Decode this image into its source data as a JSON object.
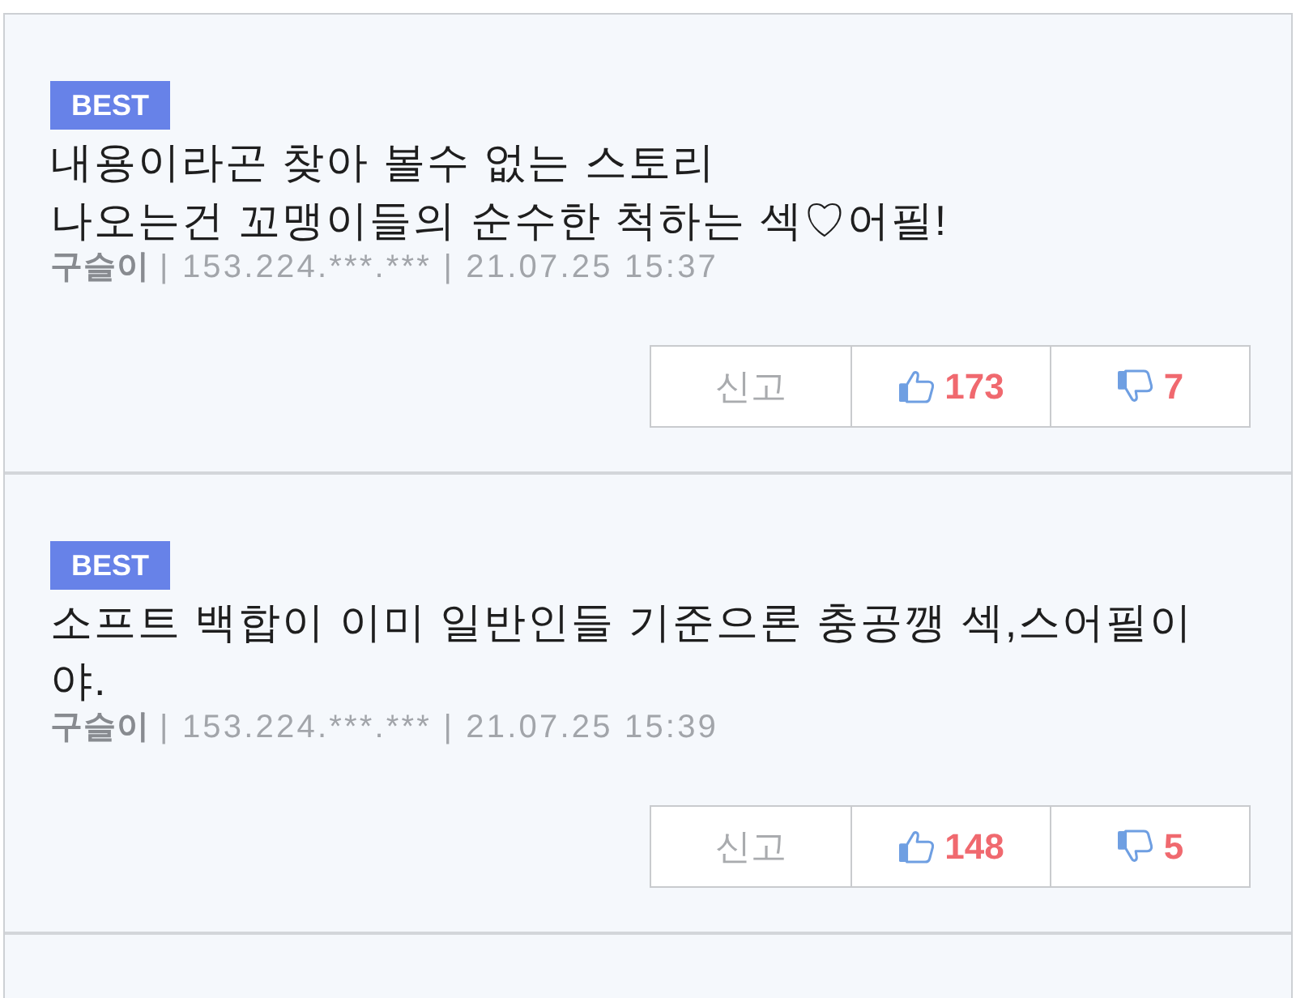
{
  "comments": [
    {
      "badge": "BEST",
      "lines": [
        "내용이라곤 찾아 볼수 없는 스토리",
        "나오는건 꼬맹이들의 순수한 척하는 섹♡어필!"
      ],
      "author": "구슬이",
      "info": "| 153.224.***.*** | 21.07.25 15:37",
      "buttons": [
        {
          "kind": "report",
          "label": "신고"
        },
        {
          "kind": "like",
          "label": "173"
        },
        {
          "kind": "dislike",
          "label": "7"
        }
      ]
    },
    {
      "badge": "BEST",
      "lines": [
        "소프트 백합이 이미 일반인들 기준으론 충공깽 섹,스어필이",
        "야."
      ],
      "author": "구슬이",
      "info": "| 153.224.***.*** | 21.07.25 15:39",
      "buttons": [
        {
          "kind": "report",
          "label": "신고"
        },
        {
          "kind": "like",
          "label": "148"
        },
        {
          "kind": "dislike",
          "label": "5"
        }
      ]
    }
  ]
}
